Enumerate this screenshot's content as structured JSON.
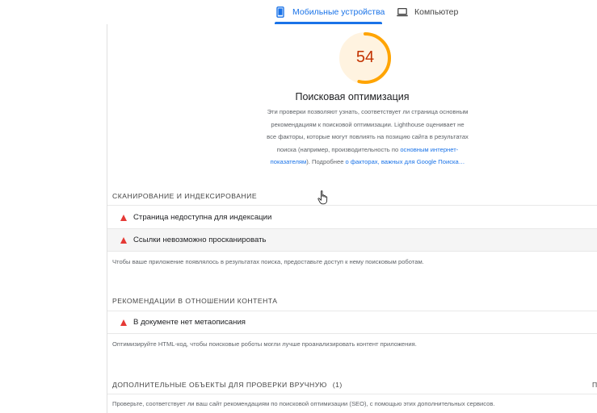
{
  "tabs": [
    {
      "label": "Мобильные устройства",
      "icon": "mobile-phone-icon",
      "active": true
    },
    {
      "label": "Компьютер",
      "icon": "laptop-icon",
      "active": false
    }
  ],
  "category": {
    "score": "54",
    "title": "Поисковая оптимизация",
    "desc": {
      "line1": "Эти проверки позволяют узнать, соответствует ли страница основным",
      "line2": "рекомендациям к поисковой оптимизации. Lighthouse оценивает не",
      "line3": "все факторы, которые могут повлиять на позицию сайта в результатах",
      "line4_text": "поиска (например, производительность по ",
      "line4_link": "основным интернет-",
      "line5_link": "показателям",
      "line5_text": "). Подробнее ",
      "line5_link2": "о факторах, важных для Google Поиска…"
    },
    "colors": {
      "gauge_fail": "#c33300",
      "gauge_arc": "#ffa400",
      "gauge_bg": "#fff3e0"
    }
  },
  "sections": {
    "crawl": {
      "title": "СКАНИРОВАНИЕ И ИНДЕКСИРОВАНИЕ",
      "audits": [
        "Страница недоступна для индексации",
        "Ссылки невозможно просканировать"
      ],
      "note": "Чтобы ваше приложение появлялось в результатах поиска, предоставьте доступ к нему поисковым роботам."
    },
    "content": {
      "title": "РЕКОМЕНДАЦИИ В ОТНОШЕНИИ КОНТЕНТА",
      "audits": [
        "В документе нет метаописания"
      ],
      "note": "Оптимизируйте HTML-код, чтобы поисковые роботы могли лучше проанализировать контент приложения."
    },
    "manual": {
      "title": "ДОПОЛНИТЕЛЬНЫЕ ОБЪЕКТЫ ДЛЯ ПРОВЕРКИ ВРУЧНУЮ",
      "count": "(1)",
      "edge": "П",
      "note": "Проверьте, соответствует ли ваш сайт рекомендациям по поисковой оптимизации (SEO), с помощью этих дополнительных сервисов."
    }
  },
  "status": {
    "audit_icon": "fail-triangle-icon",
    "fail_color": "#e53935",
    "accent": "#1a73e8"
  }
}
